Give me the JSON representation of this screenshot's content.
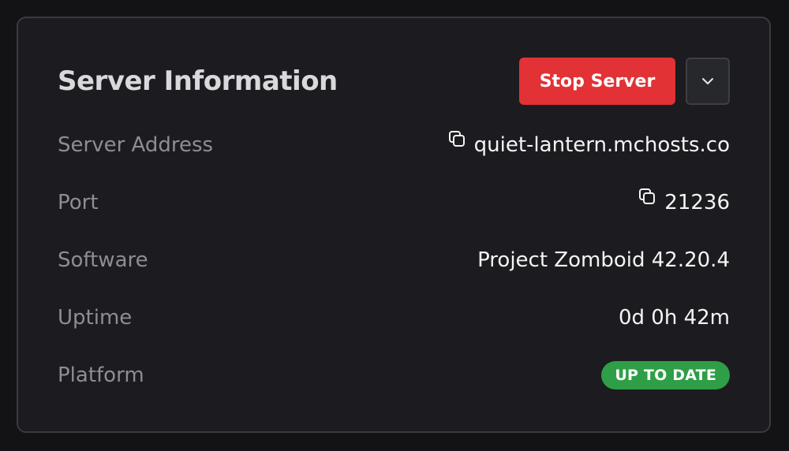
{
  "header": {
    "title": "Server Information",
    "stop_button_label": "Stop Server",
    "dropdown_icon": "chevron-down-icon"
  },
  "rows": [
    {
      "label": "Server Address",
      "value": "quiet-lantern.mchosts.co",
      "copy_icon": "copy-icon"
    },
    {
      "label": "Port",
      "value": "21236",
      "copy_icon": "copy-icon"
    },
    {
      "label": "Software",
      "value": "Project Zomboid 42.20.4"
    },
    {
      "label": "Uptime",
      "value": "0d 0h 42m"
    },
    {
      "label": "Platform",
      "badge": "UP TO DATE"
    }
  ],
  "colors": {
    "background": "#131316",
    "card": "#1c1c20",
    "card_border": "#3a3b40",
    "stop_button": "#e23236",
    "badge_green": "#2e9e47",
    "label_text": "#8d8e93",
    "value_text": "#f4f4f5"
  }
}
